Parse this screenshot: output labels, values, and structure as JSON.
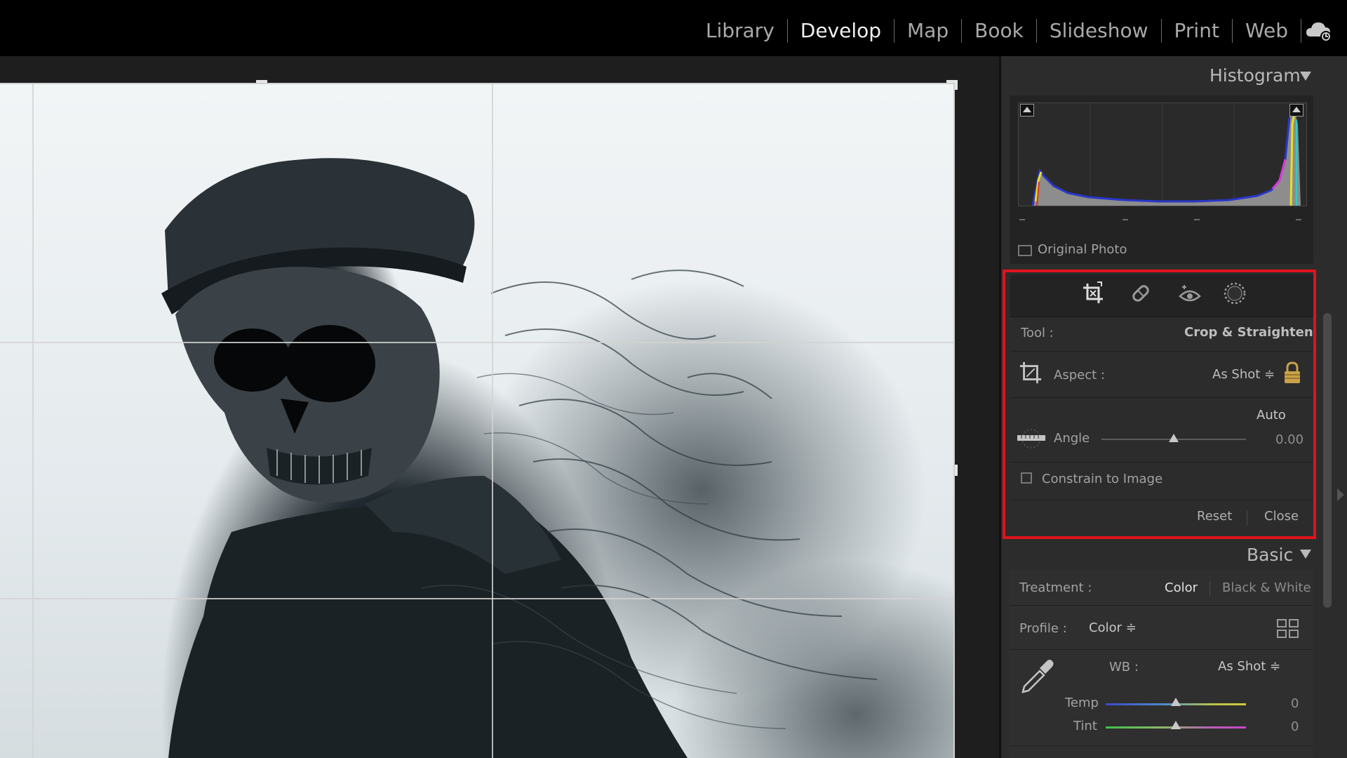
{
  "modules": [
    "Library",
    "Develop",
    "Map",
    "Book",
    "Slideshow",
    "Print",
    "Web"
  ],
  "active_module": "Develop",
  "histogram": {
    "title": "Histogram",
    "original_photo_label": "Original Photo"
  },
  "crop_tool": {
    "tool_label": "Tool :",
    "tool_name": "Crop & Straighten",
    "aspect_label": "Aspect :",
    "aspect_value": "As Shot ≑",
    "auto_label": "Auto",
    "angle_label": "Angle",
    "angle_value": "0.00",
    "angle_level": 0.5,
    "constrain_label": "Constrain to Image",
    "reset_label": "Reset",
    "close_label": "Close"
  },
  "basic": {
    "title": "Basic",
    "treatment_label": "Treatment :",
    "treatment_color": "Color",
    "treatment_bw": "Black & White",
    "profile_label": "Profile :",
    "profile_value": "Color ≑",
    "wb_label": "WB :",
    "wb_value": "As Shot ≑",
    "temp_label": "Temp",
    "temp_value": "0",
    "temp_level": 0.5,
    "tint_label": "Tint",
    "tint_value": "0",
    "tint_level": 0.5
  },
  "colors": {
    "highlight_border": "#e0131c",
    "panel_bg": "#2c2c2c",
    "topbar_bg": "#000000"
  },
  "icons": [
    "cloud-sync-icon",
    "crop-overlay-icon",
    "healing-brush-icon",
    "red-eye-icon",
    "masking-icon",
    "crop-aspect-icon",
    "lock-icon",
    "straighten-icon",
    "eyedropper-icon",
    "grid-view-icon"
  ]
}
